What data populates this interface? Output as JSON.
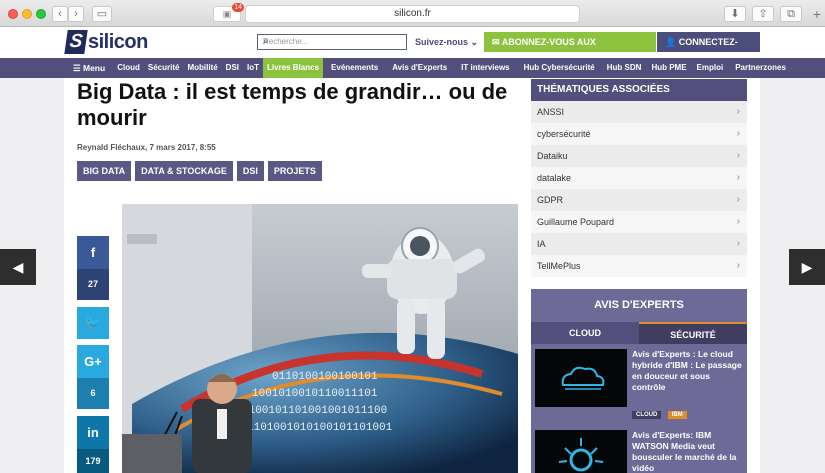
{
  "browser": {
    "url": "silicon.fr",
    "ext_count": "14"
  },
  "header": {
    "logo_text": "silicon",
    "search_placeholder": "Recherche...",
    "suivez": "Suivez-nous",
    "newsletter": "ABONNEZ-VOUS AUX NEWSLETTERS",
    "connect": "CONNECTEZ-VOUS"
  },
  "nav": {
    "menu": "Menu",
    "items": [
      "Cloud",
      "Sécurité",
      "Mobilité",
      "DSI",
      "IoT",
      "Livres Blancs",
      "Evénements",
      "Avis d'Experts",
      "IT interviews",
      "Hub Cybersécurité",
      "Hub SDN",
      "Hub PME",
      "Emploi",
      "Partnerzones"
    ]
  },
  "article": {
    "title": "Big Data : il est temps de grandir… ou de mourir",
    "byline": "Reynald Fléchaux, 7 mars 2017, 8:55",
    "tags": [
      "BIG DATA",
      "DATA & STOCKAGE",
      "DSI",
      "PROJETS"
    ],
    "social": {
      "fb": "27",
      "gplus": "6",
      "li": "179"
    }
  },
  "sidebar": {
    "themes_title": "THÉMATIQUES ASSOCIÉES",
    "themes": [
      "ANSSI",
      "cybersécurité",
      "Dataiku",
      "datalake",
      "GDPR",
      "Guillaume Poupard",
      "IA",
      "TellMePlus"
    ],
    "experts_title": "AVIS D'EXPERTS",
    "tab_cloud": "CLOUD",
    "tab_securite": "SÉCURITÉ",
    "experts": [
      {
        "title": "Avis d'Experts : Le cloud hybride d'IBM : Le passage en douceur et sous contrôle",
        "labels": [
          "CLOUD",
          "IBM"
        ]
      },
      {
        "title": "Avis d'Experts: IBM WATSON Media veut bousculer le marché de la vidéo"
      }
    ]
  },
  "colors": {
    "nav": "#524f7c",
    "green": "#8dc23f",
    "fb": "#3b5998",
    "tw": "#29a9e0"
  }
}
